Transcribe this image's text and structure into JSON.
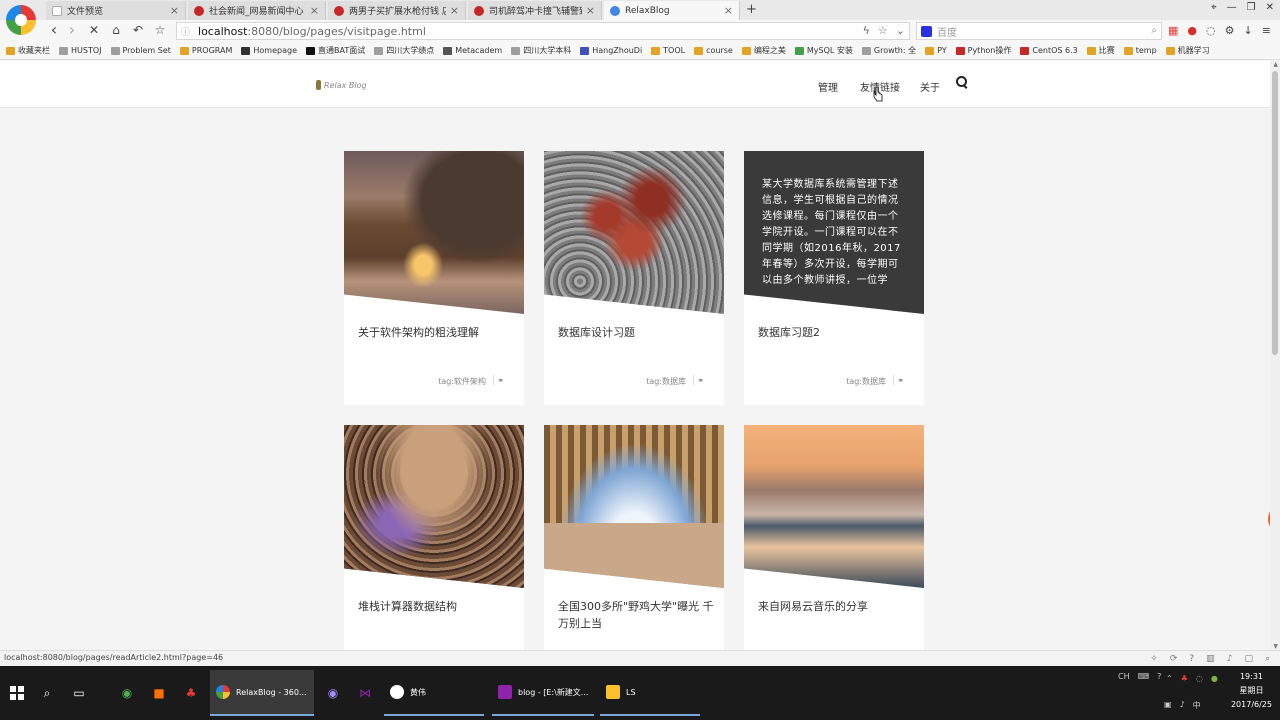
{
  "browser": {
    "tabs": [
      {
        "title": "文件预览",
        "close": "×",
        "color": "#e9e9e9"
      },
      {
        "title": "社会新闻_网易新闻中心",
        "close": "×",
        "color": "#c62828"
      },
      {
        "title": "两男子买扩展水枪付钱 店主",
        "close": "×",
        "color": "#c62828"
      },
      {
        "title": "司机醉驾冲卡撞飞辅警致其",
        "close": "×",
        "color": "#c62828"
      },
      {
        "title": "RelaxBlog",
        "close": "×",
        "color": "#3f86e6"
      }
    ],
    "new_tab": "+",
    "address": {
      "host": "localhost",
      "path": ":8080/blog/pages/visitpage.html"
    },
    "search_placeholder": "百度",
    "nav_glyphs": {
      "back": "‹",
      "forward": "›",
      "home": "⌂",
      "undo": "↶",
      "favorite": "☆",
      "stop": "✕"
    },
    "window_controls": {
      "pin": "⌖",
      "min": "—",
      "max": "❐",
      "close": "✕"
    },
    "bookmarks": [
      {
        "label": "收藏夹栏",
        "color": "#e5a323"
      },
      {
        "label": "HUSTOJ",
        "color": "#9e9e9e"
      },
      {
        "label": "Problem Set",
        "color": "#9e9e9e"
      },
      {
        "label": "PROGRAM",
        "color": "#e5a323"
      },
      {
        "label": "Homepage",
        "color": "#333333"
      },
      {
        "label": "直通BAT面试",
        "color": "#111111"
      },
      {
        "label": "四川大学绩点",
        "color": "#9e9e9e"
      },
      {
        "label": "Metacadem",
        "color": "#555555"
      },
      {
        "label": "四川大学本科",
        "color": "#9e9e9e"
      },
      {
        "label": "HangZhouDi",
        "color": "#3f51b5"
      },
      {
        "label": "TOOL",
        "color": "#e5a323"
      },
      {
        "label": "course",
        "color": "#e5a323"
      },
      {
        "label": "编程之美",
        "color": "#e5a323"
      },
      {
        "label": "MySQL 安装",
        "color": "#43a047"
      },
      {
        "label": "Growth: 全",
        "color": "#9e9e9e"
      },
      {
        "label": "PY",
        "color": "#e5a323"
      },
      {
        "label": "Python操作",
        "color": "#c62828"
      },
      {
        "label": "CentOS 6.3",
        "color": "#c62828"
      },
      {
        "label": "比赛",
        "color": "#e5a323"
      },
      {
        "label": "temp",
        "color": "#e5a323"
      },
      {
        "label": "机器学习",
        "color": "#e5a323"
      }
    ]
  },
  "site": {
    "logo": "Relax Blog",
    "nav": [
      "管理",
      "友情链接",
      "关于"
    ],
    "search_icon": "search-icon"
  },
  "cards": [
    {
      "title": "关于软件架构的粗浅理解",
      "tag": "tag:软件架构",
      "image": "rock-arch-beach"
    },
    {
      "title": "数据库设计习题",
      "tag": "tag:数据库",
      "image": "red-tree-rocks"
    },
    {
      "title": "数据库习题2",
      "tag": "tag:数据库",
      "overlay": "某大学数据库系统需管理下述信息，学生可根据自己的情况选修课程。每门课程仅由一个学院开设。一门课程可以在不同学期（如2016年秋，2017年春等）多次开设，每学期可以由多个教师讲授，一位学"
    },
    {
      "title": "堆栈计算器数据结构",
      "tag": "",
      "image": "cave"
    },
    {
      "title": "全国300多所\"野鸡大学\"曝光 千万别上当",
      "tag": "",
      "image": "arch-building"
    },
    {
      "title": "来自网易云音乐的分享",
      "tag": "",
      "image": "harbor"
    }
  ],
  "status": {
    "url": "localhost:8080/blog/pages/readArticle2.html?page=46"
  },
  "taskbar": {
    "apps": [
      {
        "label": "RelaxBlog - 360...",
        "color": "#3f86e6",
        "active": true
      },
      {
        "label": "黄伟",
        "color": "#ffffff",
        "active": false
      },
      {
        "label": "blog - [E:\\新建文...",
        "color": "#8e24aa",
        "active": false
      },
      {
        "label": "LS",
        "color": "#fbc02d",
        "active": false
      }
    ],
    "time": "19:31",
    "weekday": "星期日",
    "date": "2017/6/25",
    "ime": "CH"
  }
}
